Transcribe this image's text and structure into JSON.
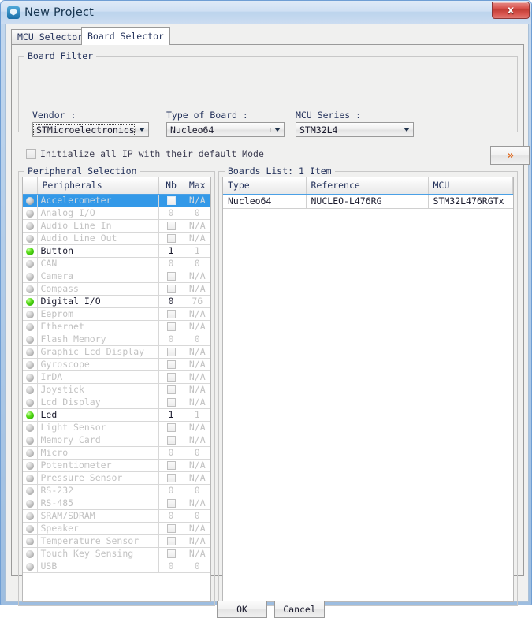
{
  "window": {
    "title": "New Project",
    "icon": "cube-shield-icon",
    "close_label": "x"
  },
  "tabs": [
    {
      "id": "mcu-selector",
      "label": "MCU Selector",
      "active": false
    },
    {
      "id": "board-selector",
      "label": "Board Selector",
      "active": true
    }
  ],
  "board_filter": {
    "group_title": "Board Filter",
    "vendor": {
      "label": "Vendor :",
      "value": "STMicroelectronics",
      "focused": true
    },
    "type_of_board": {
      "label": "Type of Board :",
      "value": "Nucleo64",
      "focused": false
    },
    "mcu_series": {
      "label": "MCU Series :",
      "value": "STM32L4",
      "focused": false
    },
    "init_checkbox": {
      "label": "Initialize all IP with their default Mode",
      "checked": false
    },
    "expand_button": {
      "label": "»",
      "name": "expand-filters-button"
    }
  },
  "peripheral_selection": {
    "group_title": "Peripheral Selection",
    "columns": [
      "",
      "Peripherals",
      "Nb",
      "Max"
    ],
    "rows": [
      {
        "led": "off",
        "name": "Accelerometer",
        "nb": "",
        "nb_type": "checkbox",
        "max": "N/A",
        "state": "selected"
      },
      {
        "led": "off",
        "name": "Analog I/O",
        "nb": "0",
        "nb_type": "text",
        "max": "0",
        "state": "disabled"
      },
      {
        "led": "off",
        "name": "Audio Line In",
        "nb": "",
        "nb_type": "checkbox",
        "max": "N/A",
        "state": "disabled"
      },
      {
        "led": "off",
        "name": "Audio Line Out",
        "nb": "",
        "nb_type": "checkbox",
        "max": "N/A",
        "state": "disabled"
      },
      {
        "led": "on",
        "name": "Button",
        "nb": "1",
        "nb_type": "text",
        "max": "1",
        "state": "enabled"
      },
      {
        "led": "off",
        "name": "CAN",
        "nb": "0",
        "nb_type": "text",
        "max": "0",
        "state": "disabled"
      },
      {
        "led": "off",
        "name": "Camera",
        "nb": "",
        "nb_type": "checkbox",
        "max": "N/A",
        "state": "disabled"
      },
      {
        "led": "off",
        "name": "Compass",
        "nb": "",
        "nb_type": "checkbox",
        "max": "N/A",
        "state": "disabled"
      },
      {
        "led": "on",
        "name": "Digital I/O",
        "nb": "0",
        "nb_type": "text",
        "max": "76",
        "state": "enabled"
      },
      {
        "led": "off",
        "name": "Eeprom",
        "nb": "",
        "nb_type": "checkbox",
        "max": "N/A",
        "state": "disabled"
      },
      {
        "led": "off",
        "name": "Ethernet",
        "nb": "",
        "nb_type": "checkbox",
        "max": "N/A",
        "state": "disabled"
      },
      {
        "led": "off",
        "name": "Flash Memory",
        "nb": "0",
        "nb_type": "text",
        "max": "0",
        "state": "disabled"
      },
      {
        "led": "off",
        "name": "Graphic Lcd Display",
        "nb": "",
        "nb_type": "checkbox",
        "max": "N/A",
        "state": "disabled"
      },
      {
        "led": "off",
        "name": "Gyroscope",
        "nb": "",
        "nb_type": "checkbox",
        "max": "N/A",
        "state": "disabled"
      },
      {
        "led": "off",
        "name": "IrDA",
        "nb": "",
        "nb_type": "checkbox",
        "max": "N/A",
        "state": "disabled"
      },
      {
        "led": "off",
        "name": "Joystick",
        "nb": "",
        "nb_type": "checkbox",
        "max": "N/A",
        "state": "disabled"
      },
      {
        "led": "off",
        "name": "Lcd Display",
        "nb": "",
        "nb_type": "checkbox",
        "max": "N/A",
        "state": "disabled"
      },
      {
        "led": "on",
        "name": "Led",
        "nb": "1",
        "nb_type": "text",
        "max": "1",
        "state": "enabled"
      },
      {
        "led": "off",
        "name": "Light Sensor",
        "nb": "",
        "nb_type": "checkbox",
        "max": "N/A",
        "state": "disabled"
      },
      {
        "led": "off",
        "name": "Memory Card",
        "nb": "",
        "nb_type": "checkbox",
        "max": "N/A",
        "state": "disabled"
      },
      {
        "led": "off",
        "name": "Micro",
        "nb": "0",
        "nb_type": "text",
        "max": "0",
        "state": "disabled"
      },
      {
        "led": "off",
        "name": "Potentiometer",
        "nb": "",
        "nb_type": "checkbox",
        "max": "N/A",
        "state": "disabled"
      },
      {
        "led": "off",
        "name": "Pressure Sensor",
        "nb": "",
        "nb_type": "checkbox",
        "max": "N/A",
        "state": "disabled"
      },
      {
        "led": "off",
        "name": "RS-232",
        "nb": "0",
        "nb_type": "text",
        "max": "0",
        "state": "disabled"
      },
      {
        "led": "off",
        "name": "RS-485",
        "nb": "",
        "nb_type": "checkbox",
        "max": "N/A",
        "state": "disabled"
      },
      {
        "led": "off",
        "name": "SRAM/SDRAM",
        "nb": "0",
        "nb_type": "text",
        "max": "0",
        "state": "disabled"
      },
      {
        "led": "off",
        "name": "Speaker",
        "nb": "",
        "nb_type": "checkbox",
        "max": "N/A",
        "state": "disabled"
      },
      {
        "led": "off",
        "name": "Temperature Sensor",
        "nb": "",
        "nb_type": "checkbox",
        "max": "N/A",
        "state": "disabled"
      },
      {
        "led": "off",
        "name": "Touch Key Sensing",
        "nb": "",
        "nb_type": "checkbox",
        "max": "N/A",
        "state": "disabled"
      },
      {
        "led": "off",
        "name": "USB",
        "nb": "0",
        "nb_type": "text",
        "max": "0",
        "state": "disabled"
      }
    ]
  },
  "boards_list": {
    "group_title": "Boards List: 1 Item",
    "columns": [
      "Type",
      "Reference",
      "MCU"
    ],
    "rows": [
      {
        "type": "Nucleo64",
        "reference": "NUCLEO-L476RG",
        "mcu": "STM32L476RGTx"
      }
    ]
  },
  "footer": {
    "ok_label": "OK",
    "cancel_label": "Cancel"
  },
  "colors": {
    "selection_blue": "#3399e8",
    "led_on_green": "#19a200",
    "close_red": "#c03b34",
    "chevron_orange": "#e06a1f"
  }
}
